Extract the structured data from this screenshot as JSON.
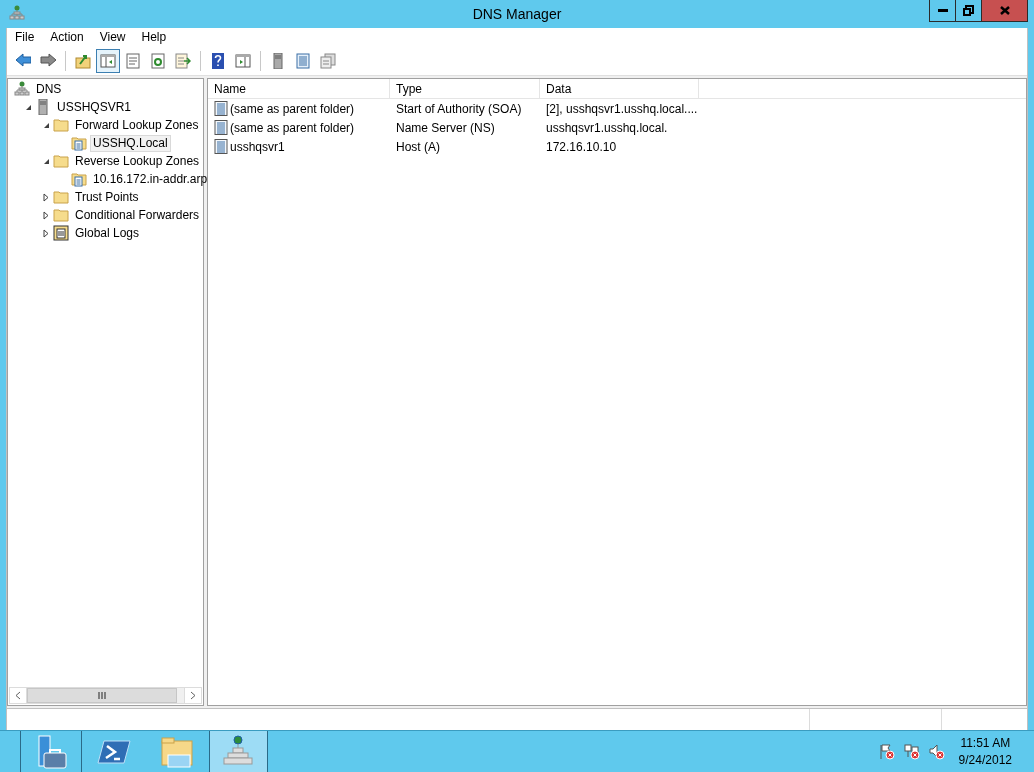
{
  "window": {
    "title": "DNS Manager"
  },
  "menu": [
    "File",
    "Action",
    "View",
    "Help"
  ],
  "toolbar": [
    {
      "kind": "back",
      "pressed": false
    },
    {
      "kind": "forward",
      "pressed": false
    },
    {
      "kind": "sep"
    },
    {
      "kind": "up",
      "pressed": false
    },
    {
      "kind": "tree",
      "pressed": true
    },
    {
      "kind": "properties",
      "pressed": false
    },
    {
      "kind": "refresh",
      "pressed": false
    },
    {
      "kind": "export",
      "pressed": false
    },
    {
      "kind": "sep"
    },
    {
      "kind": "help",
      "pressed": false
    },
    {
      "kind": "action",
      "pressed": false
    },
    {
      "kind": "sep"
    },
    {
      "kind": "server",
      "pressed": false
    },
    {
      "kind": "list",
      "pressed": false
    },
    {
      "kind": "copy",
      "pressed": false
    }
  ],
  "tree": [
    {
      "label": "DNS",
      "kind": "dns",
      "selected": false,
      "children": [
        {
          "label": "USSHQSVR1",
          "kind": "server",
          "expanded": true,
          "selected": false,
          "children": [
            {
              "label": "Forward Lookup Zones",
              "kind": "folder",
              "expanded": true,
              "selected": false,
              "children": [
                {
                  "label": "USSHQ.Local",
                  "kind": "zone",
                  "selected": true
                }
              ]
            },
            {
              "label": "Reverse Lookup Zones",
              "kind": "folder",
              "expanded": true,
              "selected": false,
              "children": [
                {
                  "label": "10.16.172.in-addr.arp",
                  "kind": "zone",
                  "selected": false
                }
              ]
            },
            {
              "label": "Trust Points",
              "kind": "folder",
              "expanded": false,
              "selected": false
            },
            {
              "label": "Conditional Forwarders",
              "kind": "folder",
              "expanded": false,
              "selected": false
            },
            {
              "label": "Global Logs",
              "kind": "log",
              "expanded": false,
              "selected": false
            }
          ]
        }
      ]
    }
  ],
  "table": {
    "columns": [
      "Name",
      "Type",
      "Data"
    ],
    "rows": [
      {
        "name": "(same as parent folder)",
        "type": "Start of Authority (SOA)",
        "data": "[2], usshqsvr1.usshq.local....",
        "selected": false
      },
      {
        "name": "(same as parent folder)",
        "type": "Name Server (NS)",
        "data": "usshqsvr1.usshq.local.",
        "selected": false
      },
      {
        "name": "usshqsvr1",
        "type": "Host (A)",
        "data": "172.16.10.10",
        "selected": false
      }
    ]
  },
  "taskbar": {
    "apps": [
      {
        "kind": "server-manager",
        "selected": false
      },
      {
        "kind": "powershell",
        "selected": false
      },
      {
        "kind": "explorer",
        "selected": false
      },
      {
        "kind": "dns",
        "selected": true
      }
    ],
    "tray": [
      {
        "kind": "flag"
      },
      {
        "kind": "network"
      },
      {
        "kind": "volume"
      }
    ],
    "clock": {
      "time": "11:51 AM",
      "date": "9/24/2012"
    }
  }
}
